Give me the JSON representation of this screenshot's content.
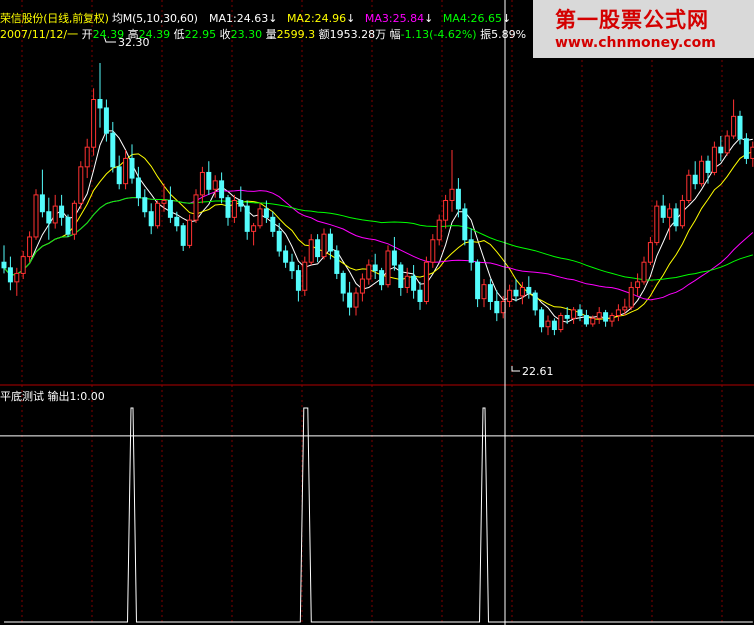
{
  "header": {
    "stock": "荣信股份(日线,前复权)",
    "ma_label": "均M(5,10,30,60)",
    "date": "2007/11/12/一",
    "open_label": "开",
    "open": "24.39",
    "high_label": "高",
    "high": "24.39",
    "low_label": "低",
    "low": "22.95",
    "close_label": "收",
    "close": "23.30",
    "vol_label": "量",
    "vol": "2599.3",
    "amt_label": "额",
    "amt": "1953.28万",
    "chg_label": "幅",
    "chg": "-1.13(-4.62%)",
    "amp_label": "振",
    "amp": "5.89%",
    "ma_values": [
      {
        "text": "MA1:24.63",
        "color": "#ffffff"
      },
      {
        "text": "MA2:24.96",
        "color": "#ffff00"
      },
      {
        "text": "MA3:25.84",
        "color": "#ff00ff"
      },
      {
        "text": "MA4:26.65",
        "color": "#00ff00"
      }
    ],
    "arrow_glyph": "↓"
  },
  "sub_panel": {
    "title": "平底测试 输出1:0.00"
  },
  "watermark": {
    "name": "第一股票公式网",
    "url": "www.chnmoney.com"
  },
  "colors": {
    "up": "#ff3232",
    "down": "#54fcfc",
    "ma1": "#ffffff",
    "ma2": "#ffff00",
    "ma3": "#ff00ff",
    "ma4": "#00ff00",
    "grid": "#800000",
    "frame": "#b00000",
    "text_yellow": "#ffff00",
    "text_green": "#00ff00",
    "text_red": "#ff5050"
  },
  "chart_data": [
    {
      "type": "candlestick",
      "title": "荣信股份(日线,前复权)",
      "annotations": [
        {
          "text": "32.30",
          "kind": "high_marker"
        },
        {
          "text": "22.61",
          "kind": "low_marker"
        }
      ],
      "ylim": [
        21.5,
        33.3
      ],
      "ohlc": [
        [
          25.2,
          25.8,
          24.8,
          25.0
        ],
        [
          25.0,
          25.4,
          24.2,
          24.5
        ],
        [
          24.5,
          25.0,
          24.0,
          24.8
        ],
        [
          24.8,
          25.6,
          24.6,
          25.4
        ],
        [
          25.4,
          26.3,
          25.2,
          26.1
        ],
        [
          26.1,
          27.8,
          26.0,
          27.6
        ],
        [
          27.6,
          28.5,
          26.8,
          27.0
        ],
        [
          27.0,
          27.5,
          26.0,
          26.6
        ],
        [
          26.6,
          27.6,
          26.4,
          27.2
        ],
        [
          27.2,
          27.6,
          26.5,
          26.8
        ],
        [
          26.8,
          26.9,
          26.1,
          26.2
        ],
        [
          26.2,
          27.4,
          26.0,
          27.3
        ],
        [
          27.3,
          28.8,
          27.1,
          28.6
        ],
        [
          28.6,
          29.6,
          28.2,
          29.3
        ],
        [
          29.3,
          31.4,
          29.0,
          31.0
        ],
        [
          31.0,
          32.3,
          30.0,
          30.7
        ],
        [
          30.7,
          31.0,
          29.5,
          29.8
        ],
        [
          29.8,
          30.2,
          28.4,
          28.6
        ],
        [
          28.6,
          29.0,
          27.8,
          28.0
        ],
        [
          28.0,
          29.2,
          27.8,
          28.9
        ],
        [
          28.9,
          29.4,
          28.0,
          28.2
        ],
        [
          28.2,
          28.6,
          27.2,
          27.5
        ],
        [
          27.5,
          27.8,
          26.8,
          27.0
        ],
        [
          27.0,
          27.3,
          26.2,
          26.5
        ],
        [
          26.5,
          27.4,
          26.4,
          27.3
        ],
        [
          27.3,
          28.0,
          27.0,
          27.4
        ],
        [
          27.4,
          27.9,
          26.6,
          26.8
        ],
        [
          26.8,
          27.0,
          26.3,
          26.5
        ],
        [
          26.5,
          26.6,
          25.6,
          25.8
        ],
        [
          25.8,
          26.9,
          25.7,
          26.7
        ],
        [
          26.7,
          27.8,
          26.6,
          27.6
        ],
        [
          27.6,
          28.6,
          27.3,
          28.4
        ],
        [
          28.4,
          28.8,
          27.6,
          27.8
        ],
        [
          27.8,
          28.3,
          27.5,
          28.1
        ],
        [
          28.1,
          28.4,
          27.3,
          27.5
        ],
        [
          27.5,
          27.6,
          26.5,
          26.8
        ],
        [
          26.8,
          27.6,
          26.6,
          27.4
        ],
        [
          27.4,
          27.9,
          27.0,
          27.2
        ],
        [
          27.2,
          27.4,
          26.0,
          26.3
        ],
        [
          26.3,
          26.6,
          25.8,
          26.5
        ],
        [
          26.5,
          27.3,
          26.4,
          27.1
        ],
        [
          27.1,
          27.4,
          26.6,
          26.8
        ],
        [
          26.8,
          27.0,
          26.1,
          26.3
        ],
        [
          26.3,
          26.6,
          25.4,
          25.6
        ],
        [
          25.6,
          25.8,
          25.0,
          25.2
        ],
        [
          25.2,
          25.5,
          24.6,
          24.9
        ],
        [
          24.9,
          25.1,
          23.8,
          24.2
        ],
        [
          24.2,
          25.4,
          24.0,
          25.2
        ],
        [
          25.2,
          26.2,
          25.1,
          26.0
        ],
        [
          26.0,
          26.2,
          25.2,
          25.4
        ],
        [
          25.4,
          26.4,
          25.3,
          26.2
        ],
        [
          26.2,
          26.4,
          25.3,
          25.6
        ],
        [
          25.6,
          25.8,
          24.6,
          24.8
        ],
        [
          24.8,
          24.9,
          23.8,
          24.1
        ],
        [
          24.1,
          24.5,
          23.3,
          23.6
        ],
        [
          23.6,
          24.3,
          23.3,
          24.1
        ],
        [
          24.1,
          24.8,
          23.8,
          24.6
        ],
        [
          24.6,
          25.3,
          24.4,
          25.1
        ],
        [
          25.1,
          25.5,
          24.6,
          24.9
        ],
        [
          24.9,
          25.0,
          24.2,
          24.4
        ],
        [
          24.4,
          25.8,
          24.3,
          25.6
        ],
        [
          25.6,
          26.1,
          24.9,
          25.1
        ],
        [
          25.1,
          25.2,
          24.0,
          24.3
        ],
        [
          24.3,
          25.0,
          24.1,
          24.7
        ],
        [
          24.7,
          25.1,
          23.9,
          24.2
        ],
        [
          24.2,
          24.5,
          23.5,
          23.8
        ],
        [
          23.8,
          25.4,
          23.7,
          25.2
        ],
        [
          25.2,
          26.2,
          25.0,
          26.0
        ],
        [
          26.0,
          26.9,
          25.8,
          26.7
        ],
        [
          26.7,
          27.6,
          26.4,
          27.4
        ],
        [
          27.4,
          29.2,
          27.0,
          27.8
        ],
        [
          27.8,
          28.2,
          26.8,
          27.1
        ],
        [
          27.1,
          27.3,
          25.8,
          26.0
        ],
        [
          26.0,
          26.4,
          24.9,
          25.2
        ],
        [
          25.2,
          25.3,
          23.6,
          23.9
        ],
        [
          23.9,
          24.6,
          23.6,
          24.4
        ],
        [
          24.4,
          24.6,
          23.5,
          23.8
        ],
        [
          23.8,
          24.2,
          23.1,
          23.4
        ],
        [
          23.4,
          24.0,
          23.2,
          23.8
        ],
        [
          23.8,
          24.4,
          23.6,
          24.2
        ],
        [
          24.2,
          24.6,
          23.8,
          24.0
        ],
        [
          24.0,
          24.5,
          23.7,
          24.3
        ],
        [
          24.3,
          24.7,
          23.9,
          24.1
        ],
        [
          24.1,
          24.2,
          23.3,
          23.5
        ],
        [
          23.5,
          23.6,
          22.7,
          22.9
        ],
        [
          22.9,
          23.3,
          22.6,
          23.1
        ],
        [
          23.1,
          23.2,
          22.6,
          22.8
        ],
        [
          22.8,
          23.4,
          22.7,
          23.3
        ],
        [
          23.3,
          23.6,
          23.0,
          23.2
        ],
        [
          23.2,
          23.6,
          23.0,
          23.5
        ],
        [
          23.5,
          23.7,
          23.1,
          23.3
        ],
        [
          23.3,
          23.5,
          22.9,
          23.0
        ],
        [
          23.0,
          23.3,
          22.9,
          23.2
        ],
        [
          23.2,
          23.6,
          23.0,
          23.4
        ],
        [
          23.4,
          23.5,
          22.9,
          23.1
        ],
        [
          23.1,
          23.4,
          22.9,
          23.3
        ],
        [
          23.3,
          23.7,
          23.1,
          23.5
        ],
        [
          23.5,
          23.9,
          23.3,
          23.6
        ],
        [
          23.6,
          24.5,
          23.5,
          24.3
        ],
        [
          24.3,
          24.8,
          24.0,
          24.5
        ],
        [
          24.5,
          25.4,
          24.4,
          25.2
        ],
        [
          25.2,
          26.1,
          25.1,
          25.9
        ],
        [
          25.9,
          27.4,
          25.8,
          27.2
        ],
        [
          27.2,
          27.6,
          26.6,
          26.8
        ],
        [
          26.8,
          27.3,
          26.0,
          27.1
        ],
        [
          27.1,
          27.3,
          26.3,
          26.5
        ],
        [
          26.5,
          27.6,
          26.4,
          27.4
        ],
        [
          27.4,
          28.5,
          27.3,
          28.3
        ],
        [
          28.3,
          28.8,
          27.8,
          28.0
        ],
        [
          28.0,
          29.0,
          27.9,
          28.8
        ],
        [
          28.8,
          29.0,
          28.0,
          28.4
        ],
        [
          28.4,
          29.5,
          28.3,
          29.3
        ],
        [
          29.3,
          29.7,
          28.8,
          29.1
        ],
        [
          29.1,
          29.9,
          29.0,
          29.7
        ],
        [
          29.7,
          31.0,
          29.6,
          30.4
        ],
        [
          30.4,
          30.6,
          29.4,
          29.6
        ],
        [
          29.6,
          29.8,
          28.7,
          28.9
        ],
        [
          28.9,
          29.5,
          28.6,
          29.3
        ]
      ],
      "ma_series": [
        {
          "name": "MA1",
          "period": 5
        },
        {
          "name": "MA2",
          "period": 10
        },
        {
          "name": "MA3",
          "period": 30
        },
        {
          "name": "MA4",
          "period": 60
        }
      ]
    },
    {
      "type": "line",
      "title": "平底测试 输出1:0.00",
      "ylim": [
        0,
        1
      ],
      "baseline": 0.87,
      "spikes": [
        {
          "index": 20,
          "value": 1,
          "width": 1
        },
        {
          "index": 47,
          "value": 1,
          "width": 2
        },
        {
          "index": 75,
          "value": 1,
          "width": 1
        }
      ]
    }
  ]
}
